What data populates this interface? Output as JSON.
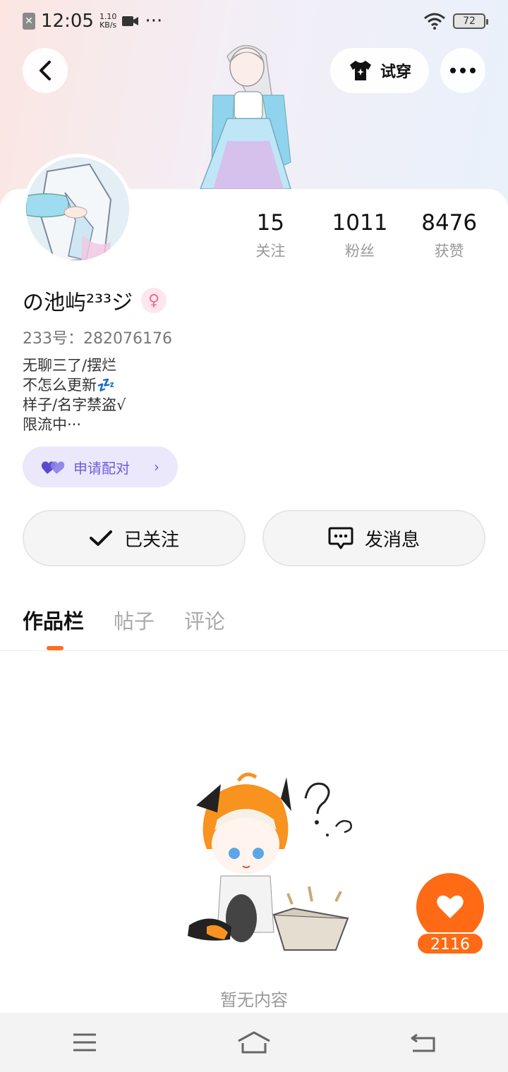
{
  "status_bar": {
    "time": "12:05",
    "net_speed_value": "1.10",
    "net_speed_unit": "KB/s",
    "more": "···",
    "battery": "72"
  },
  "header": {
    "tryon_label": "试穿"
  },
  "stats": [
    {
      "value": "15",
      "label": "关注"
    },
    {
      "value": "1011",
      "label": "粉丝"
    },
    {
      "value": "8476",
      "label": "获赞"
    }
  ],
  "profile": {
    "username": "の池屿²³³ジ",
    "uid": "233号：282076176",
    "bio": [
      "无聊三了/摆烂",
      "不怎么更新💤",
      "样子/名字禁盗√",
      "限流中···"
    ],
    "pair_label": "申请配对"
  },
  "actions": {
    "followed_label": "已关注",
    "message_label": "发消息"
  },
  "tabs": [
    {
      "label": "作品栏",
      "active": true
    },
    {
      "label": "帖子",
      "active": false
    },
    {
      "label": "评论",
      "active": false
    }
  ],
  "empty_state": {
    "text": "暂无内容"
  },
  "like": {
    "count": "2116"
  },
  "colors": {
    "accent_orange": "#ff6a14",
    "pair_purple": "#6d5fd6",
    "gender_pink": "#ef6a8d"
  }
}
